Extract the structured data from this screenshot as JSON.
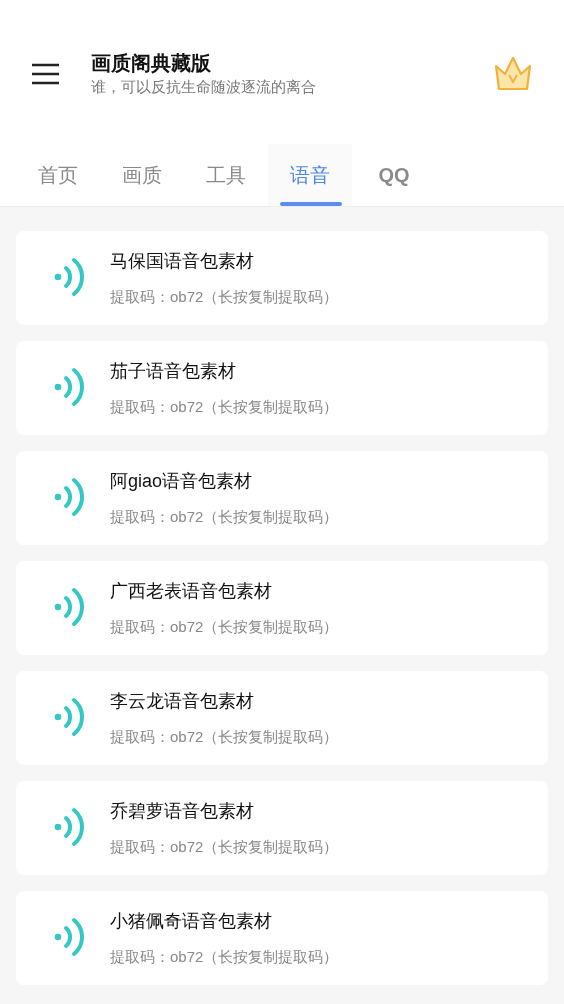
{
  "header": {
    "title": "画质阁典藏版",
    "subtitle": "谁，可以反抗生命随波逐流的离合"
  },
  "tabs": [
    {
      "label": "首页",
      "selected": false
    },
    {
      "label": "画质",
      "selected": false
    },
    {
      "label": "工具",
      "selected": false
    },
    {
      "label": "语音",
      "selected": true
    },
    {
      "label": "QQ",
      "selected": false
    }
  ],
  "items": [
    {
      "title": "马保国语音包素材",
      "code": "提取码：ob72（长按复制提取码）"
    },
    {
      "title": "茄子语音包素材",
      "code": "提取码：ob72（长按复制提取码）"
    },
    {
      "title": "阿giao语音包素材",
      "code": "提取码：ob72（长按复制提取码）"
    },
    {
      "title": "广西老表语音包素材",
      "code": "提取码：ob72（长按复制提取码）"
    },
    {
      "title": "李云龙语音包素材",
      "code": "提取码：ob72（长按复制提取码）"
    },
    {
      "title": "乔碧萝语音包素材",
      "code": "提取码：ob72（长按复制提取码）"
    },
    {
      "title": "小猪佩奇语音包素材",
      "code": "提取码：ob72（长按复制提取码）"
    }
  ]
}
